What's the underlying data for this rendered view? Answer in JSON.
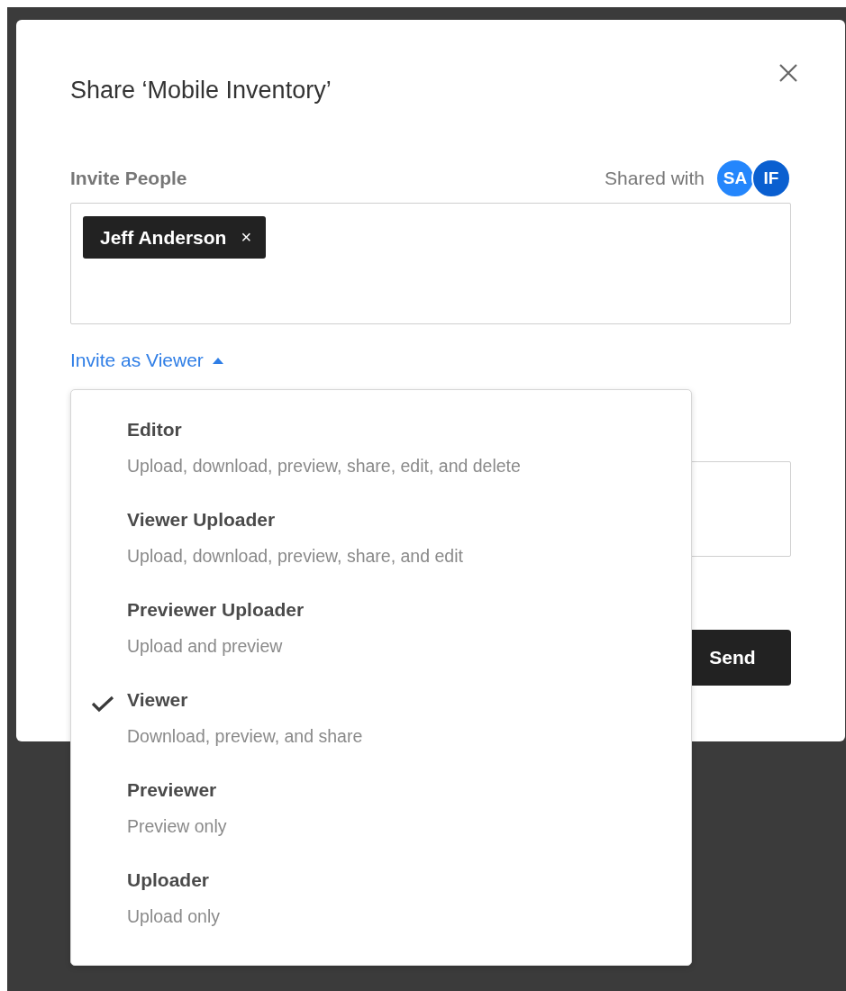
{
  "dialog": {
    "title": "Share ‘Mobile Inventory’",
    "invite_label": "Invite People",
    "shared_with": {
      "label": "Shared with",
      "avatars": [
        {
          "initials": "SA",
          "color": "#2486fc"
        },
        {
          "initials": "IF",
          "color": "#0a5fd0"
        }
      ]
    },
    "recipients": [
      {
        "name": "Jeff Anderson",
        "remove": "×"
      }
    ],
    "role_link": {
      "label": "Invite as Viewer",
      "expanded": true
    },
    "send_button": "Send"
  },
  "role_menu": {
    "items": [
      {
        "title": "Editor",
        "description": "Upload, download, preview, share, edit, and delete",
        "selected": false
      },
      {
        "title": "Viewer Uploader",
        "description": "Upload, download, preview, share, and edit",
        "selected": false
      },
      {
        "title": "Previewer Uploader",
        "description": "Upload and preview",
        "selected": false
      },
      {
        "title": "Viewer",
        "description": "Download, preview, and share",
        "selected": true
      },
      {
        "title": "Previewer",
        "description": "Preview only",
        "selected": false
      },
      {
        "title": "Uploader",
        "description": "Upload only",
        "selected": false
      }
    ]
  }
}
